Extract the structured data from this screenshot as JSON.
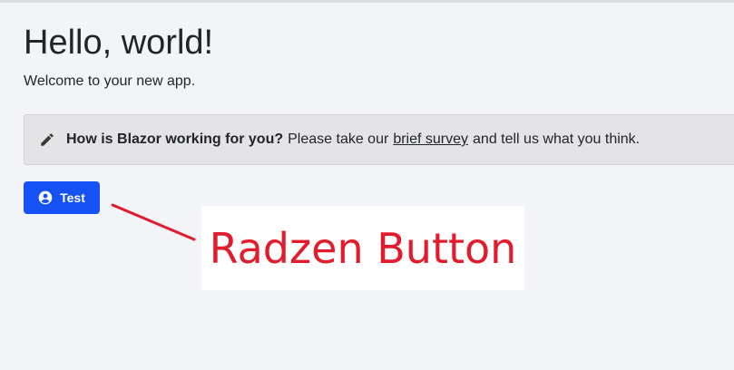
{
  "page": {
    "title": "Hello, world!",
    "subtitle": "Welcome to your new app."
  },
  "survey": {
    "bold": "How is Blazor working for you?",
    "before_link": "Please take our",
    "link_text": "brief survey",
    "after_link": "and tell us what you think.",
    "icon": "pencil-icon"
  },
  "button": {
    "label": "Test",
    "icon": "account-circle-icon",
    "color": "#1651f3"
  },
  "annotation": {
    "text": "Radzen Button",
    "color": "#e21c2d"
  }
}
